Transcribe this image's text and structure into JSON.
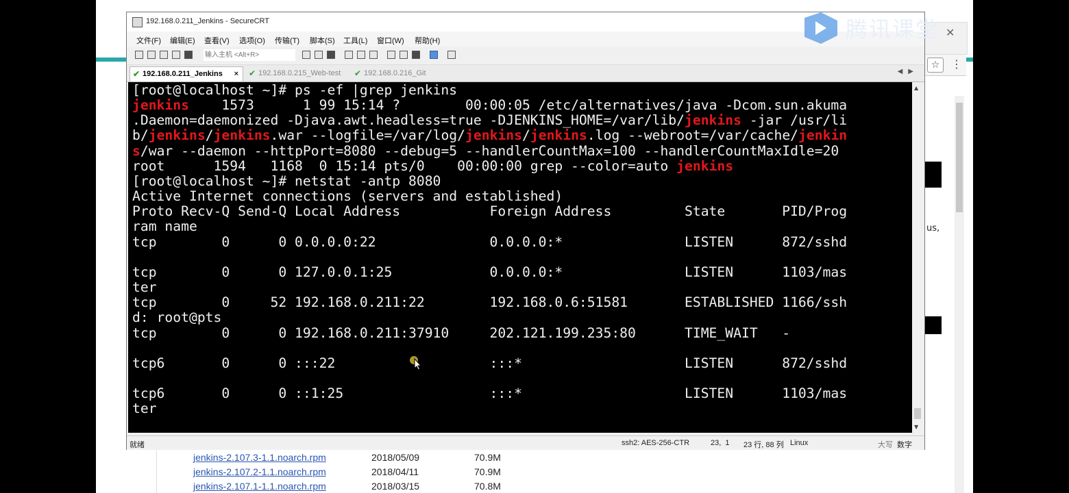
{
  "window": {
    "title": "192.168.0.211_Jenkins - SecureCRT"
  },
  "watermark": {
    "text": "腾讯课堂"
  },
  "menu": [
    "文件(F)",
    "编辑(E)",
    "查看(V)",
    "选项(O)",
    "传输(T)",
    "脚本(S)",
    "工具(L)",
    "窗口(W)",
    "帮助(H)"
  ],
  "toolbar": {
    "host_placeholder": "输入主机 <Alt+R>"
  },
  "tabs": [
    {
      "label": "192.168.0.211_Jenkins",
      "active": true
    },
    {
      "label": "192.168.0.215_Web-test",
      "active": false
    },
    {
      "label": "192.168.0.216_Git",
      "active": false
    }
  ],
  "terminal": {
    "lines": [
      [
        {
          "t": "[root@localhost ~]# ps -ef |grep jenkins"
        }
      ],
      [
        {
          "t": "jenkins",
          "r": true
        },
        {
          "t": "    1573      1 99 15:14 ?        00:00:05 /etc/alternatives/java -Dcom.sun.akuma"
        }
      ],
      [
        {
          "t": ".Daemon=daemonized -Djava.awt.headless=true -DJENKINS_HOME=/var/lib/"
        },
        {
          "t": "jenkins",
          "r": true
        },
        {
          "t": " -jar /usr/li"
        }
      ],
      [
        {
          "t": "b/"
        },
        {
          "t": "jenkins",
          "r": true
        },
        {
          "t": "/"
        },
        {
          "t": "jenkins",
          "r": true
        },
        {
          "t": ".war --logfile=/var/log/"
        },
        {
          "t": "jenkins",
          "r": true
        },
        {
          "t": "/"
        },
        {
          "t": "jenkins",
          "r": true
        },
        {
          "t": ".log --webroot=/var/cache/"
        },
        {
          "t": "jenkin",
          "r": true
        }
      ],
      [
        {
          "t": "s",
          "r": true
        },
        {
          "t": "/war --daemon --httpPort=8080 --debug=5 --handlerCountMax=100 --handlerCountMaxIdle=20"
        }
      ],
      [
        {
          "t": "root      1594   1168  0 15:14 pts/0    00:00:00 grep --color=auto "
        },
        {
          "t": "jenkins",
          "r": true
        }
      ],
      [
        {
          "t": "[root@localhost ~]# netstat -antp 8080"
        }
      ],
      [
        {
          "t": "Active Internet connections (servers and established)"
        }
      ],
      [
        {
          "t": "Proto Recv-Q Send-Q Local Address           Foreign Address         State       PID/Prog"
        }
      ],
      [
        {
          "t": "ram name"
        }
      ],
      [
        {
          "t": "tcp        0      0 0.0.0.0:22              0.0.0.0:*               LISTEN      872/sshd"
        }
      ],
      [
        {
          "t": ""
        }
      ],
      [
        {
          "t": "tcp        0      0 127.0.0.1:25            0.0.0.0:*               LISTEN      1103/mas"
        }
      ],
      [
        {
          "t": "ter"
        }
      ],
      [
        {
          "t": "tcp        0     52 192.168.0.211:22        192.168.0.6:51581       ESTABLISHED 1166/ssh"
        }
      ],
      [
        {
          "t": "d: root@pts"
        }
      ],
      [
        {
          "t": "tcp        0      0 192.168.0.211:37910     202.121.199.235:80      TIME_WAIT   -"
        }
      ],
      [
        {
          "t": ""
        }
      ],
      [
        {
          "t": "tcp6       0      0 :::22                   :::*                    LISTEN      872/sshd"
        }
      ],
      [
        {
          "t": ""
        }
      ],
      [
        {
          "t": "tcp6       0      0 ::1:25                  :::*                    LISTEN      1103/mas"
        }
      ],
      [
        {
          "t": "ter"
        }
      ]
    ]
  },
  "statusbar": {
    "ready": "就绪",
    "cipher": "ssh2: AES-256-CTR",
    "cursor_pos": "23,  1",
    "dimensions": "23 行, 88 列",
    "os": "Linux",
    "caps": "大写",
    "num": "数字"
  },
  "background_page": {
    "files": [
      {
        "name": "jenkins-2.107.3-1.1.noarch.rpm",
        "date": "2018/05/09",
        "size": "70.9M"
      },
      {
        "name": "jenkins-2.107.2-1.1.noarch.rpm",
        "date": "2018/04/11",
        "size": "70.9M"
      },
      {
        "name": "jenkins-2.107.1-1.1.noarch.rpm",
        "date": "2018/03/15",
        "size": "70.8M"
      }
    ],
    "side_text": "us,"
  }
}
